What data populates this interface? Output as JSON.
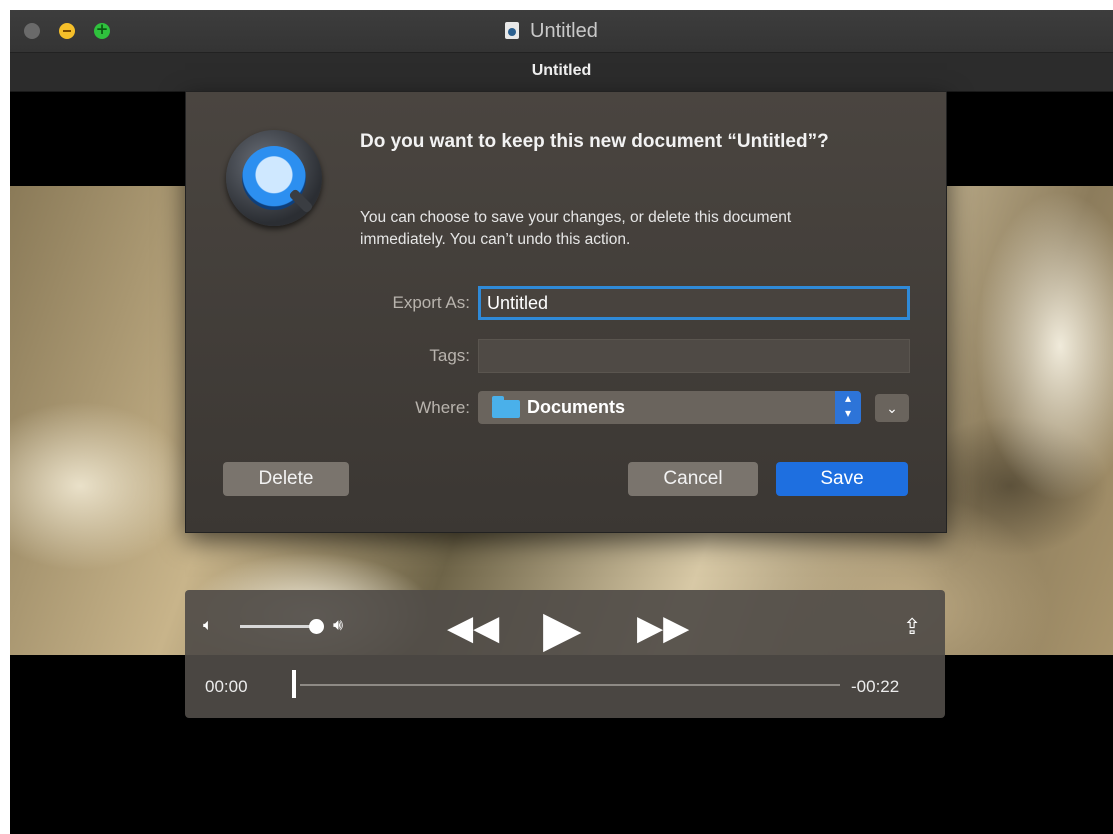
{
  "window": {
    "title": "Untitled",
    "tab_title": "Untitled"
  },
  "dialog": {
    "heading": "Do you want to keep this new document “Untitled”?",
    "message": "You can choose to save your changes, or delete this document immediately. You can’t undo this action.",
    "export_label": "Export As:",
    "export_value": "Untitled",
    "tags_label": "Tags:",
    "tags_value": "",
    "where_label": "Where:",
    "where_value": "Documents",
    "delete_label": "Delete",
    "cancel_label": "Cancel",
    "save_label": "Save",
    "accent_color": "#1e6fe0"
  },
  "player": {
    "current_time": "00:00",
    "remaining_time": "-00:22",
    "progress": 0,
    "volume": 1.0
  },
  "icons": {
    "app": "quicktime-icon",
    "document": "document-icon",
    "folder": "folder-icon",
    "share": "share-icon"
  }
}
